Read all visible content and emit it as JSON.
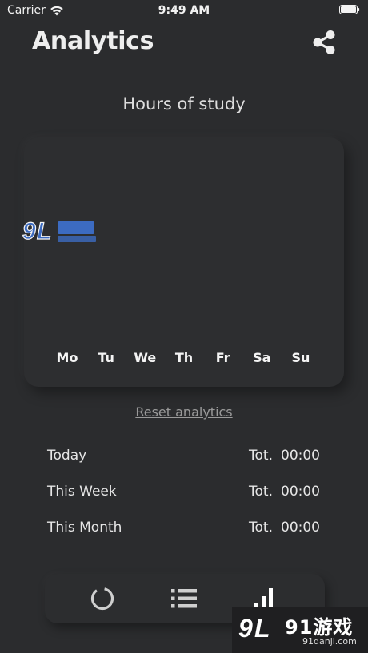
{
  "status_bar": {
    "carrier": "Carrier",
    "time": "9:49 AM"
  },
  "header": {
    "title": "Analytics",
    "share_icon": "share-icon"
  },
  "chart": {
    "title": "Hours of study",
    "days": [
      "Mo",
      "Tu",
      "We",
      "Th",
      "Fr",
      "Sa",
      "Su"
    ]
  },
  "chart_data": {
    "type": "bar",
    "title": "Hours of study",
    "categories": [
      "Mo",
      "Tu",
      "We",
      "Th",
      "Fr",
      "Sa",
      "Su"
    ],
    "values": [
      0,
      0,
      0,
      0,
      0,
      0,
      0
    ],
    "xlabel": "",
    "ylabel": "",
    "grid": false
  },
  "reset_label": "Reset analytics",
  "stats": [
    {
      "label": "Today",
      "prefix": "Tot.",
      "value": "00:00"
    },
    {
      "label": "This Week",
      "prefix": "Tot.",
      "value": "00:00"
    },
    {
      "label": "This Month",
      "prefix": "Tot.",
      "value": "00:00"
    }
  ],
  "bottom_nav": {
    "items": [
      "timer-icon",
      "list-icon",
      "analytics-icon"
    ],
    "active": "analytics-icon"
  },
  "watermark": {
    "text": "91游戏",
    "url": "91danji.com"
  },
  "colors": {
    "background": "#2b2c2e",
    "text": "#eeeeee",
    "muted": "#9a9a9a"
  }
}
